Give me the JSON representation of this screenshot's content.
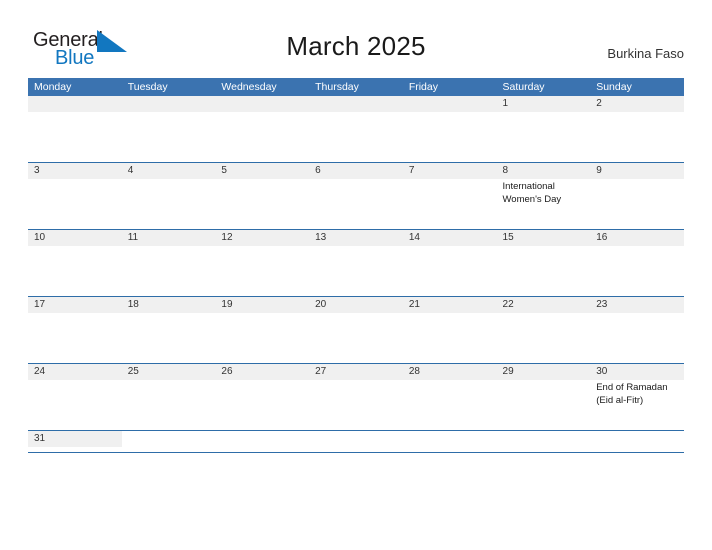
{
  "brand": {
    "name_part1": "General",
    "name_part2": "Blue",
    "flag_icon": "blue-triangle-flag-icon",
    "color_dark": "#231f20",
    "color_blue": "#1277c0"
  },
  "header": {
    "title": "March 2025",
    "country": "Burkina Faso"
  },
  "theme": {
    "header_blue": "#3b73b0",
    "row_divider_blue": "#2e6da8",
    "number_band_gray": "#f0f0f0",
    "text_dark": "#333333"
  },
  "calendar": {
    "month": "March",
    "year": "2025",
    "weekday_headers": [
      "Monday",
      "Tuesday",
      "Wednesday",
      "Thursday",
      "Friday",
      "Saturday",
      "Sunday"
    ],
    "weeks": [
      {
        "days": [
          {
            "num": "",
            "event": ""
          },
          {
            "num": "",
            "event": ""
          },
          {
            "num": "",
            "event": ""
          },
          {
            "num": "",
            "event": ""
          },
          {
            "num": "",
            "event": ""
          },
          {
            "num": "1",
            "event": ""
          },
          {
            "num": "2",
            "event": ""
          }
        ]
      },
      {
        "days": [
          {
            "num": "3",
            "event": ""
          },
          {
            "num": "4",
            "event": ""
          },
          {
            "num": "5",
            "event": ""
          },
          {
            "num": "6",
            "event": ""
          },
          {
            "num": "7",
            "event": ""
          },
          {
            "num": "8",
            "event": "International Women's Day"
          },
          {
            "num": "9",
            "event": ""
          }
        ]
      },
      {
        "days": [
          {
            "num": "10",
            "event": ""
          },
          {
            "num": "11",
            "event": ""
          },
          {
            "num": "12",
            "event": ""
          },
          {
            "num": "13",
            "event": ""
          },
          {
            "num": "14",
            "event": ""
          },
          {
            "num": "15",
            "event": ""
          },
          {
            "num": "16",
            "event": ""
          }
        ]
      },
      {
        "days": [
          {
            "num": "17",
            "event": ""
          },
          {
            "num": "18",
            "event": ""
          },
          {
            "num": "19",
            "event": ""
          },
          {
            "num": "20",
            "event": ""
          },
          {
            "num": "21",
            "event": ""
          },
          {
            "num": "22",
            "event": ""
          },
          {
            "num": "23",
            "event": ""
          }
        ]
      },
      {
        "days": [
          {
            "num": "24",
            "event": ""
          },
          {
            "num": "25",
            "event": ""
          },
          {
            "num": "26",
            "event": ""
          },
          {
            "num": "27",
            "event": ""
          },
          {
            "num": "28",
            "event": ""
          },
          {
            "num": "29",
            "event": ""
          },
          {
            "num": "30",
            "event": "End of Ramadan (Eid al-Fitr)"
          }
        ]
      },
      {
        "last": true,
        "days": [
          {
            "num": "31",
            "event": ""
          },
          {
            "num": "",
            "event": ""
          },
          {
            "num": "",
            "event": ""
          },
          {
            "num": "",
            "event": ""
          },
          {
            "num": "",
            "event": ""
          },
          {
            "num": "",
            "event": ""
          },
          {
            "num": "",
            "event": ""
          }
        ]
      }
    ]
  }
}
